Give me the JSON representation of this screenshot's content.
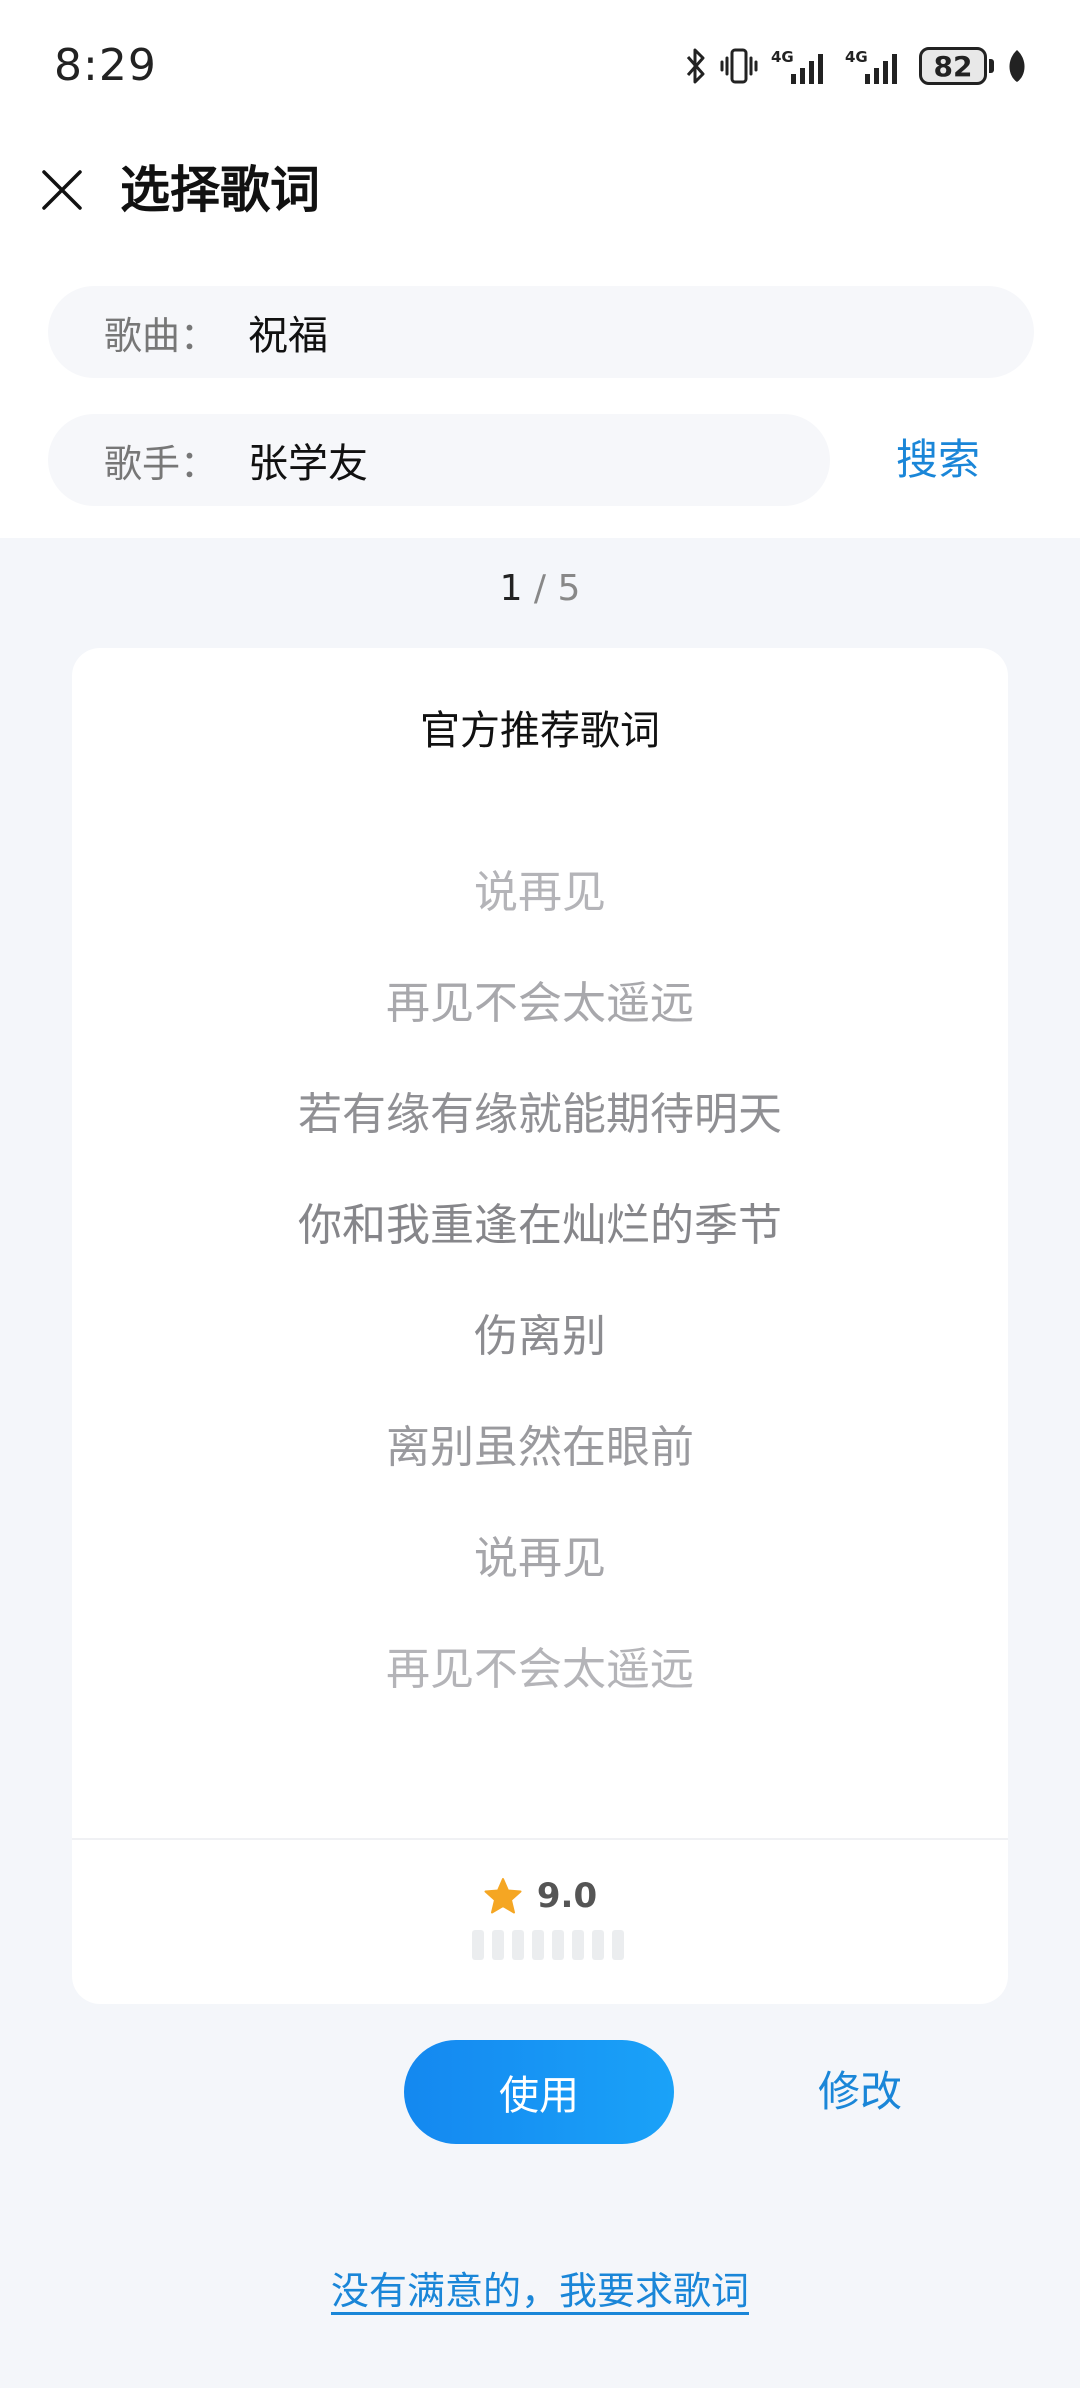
{
  "status_bar": {
    "time": "8:29",
    "battery_level": "82",
    "icons": [
      "bluetooth-icon",
      "vibrate-icon",
      "signal-4g-icon",
      "signal-4g-icon",
      "battery-icon",
      "leaf-icon"
    ],
    "network_label_1": "4G",
    "network_label_2": "4G"
  },
  "header": {
    "title": "选择歌词",
    "close_icon": "close-icon"
  },
  "form": {
    "song_label": "歌曲：",
    "song_value": "祝福",
    "artist_label": "歌手：",
    "artist_value": "张学友",
    "search_label": "搜索"
  },
  "pager": {
    "current": "1",
    "separator": " / ",
    "total": "5"
  },
  "card": {
    "title": "官方推荐歌词",
    "lyrics": [
      {
        "text": "说再见",
        "color": "#b4b4b8"
      },
      {
        "text": "再见不会太遥远",
        "color": "#a8a8ac"
      },
      {
        "text": "若有缘有缘就能期待明天",
        "color": "#909094"
      },
      {
        "text": "你和我重逢在灿烂的季节",
        "color": "#86868a"
      },
      {
        "text": "伤离别",
        "color": "#8c8c90"
      },
      {
        "text": "离别虽然在眼前",
        "color": "#9a9a9e"
      },
      {
        "text": "说再见",
        "color": "#a6a6aa"
      },
      {
        "text": "再见不会太遥远",
        "color": "#b4b4b8"
      }
    ],
    "rating": "9.0",
    "rating_icon": "star-icon",
    "star_color": "#f5a623"
  },
  "actions": {
    "use_label": "使用",
    "edit_label": "修改",
    "request_label": "没有满意的，我要求歌词"
  },
  "colors": {
    "accent": "#1a86d8",
    "button_gradient_start": "#1488f0",
    "button_gradient_end": "#1aa2f8",
    "background": "#f4f6fa"
  }
}
